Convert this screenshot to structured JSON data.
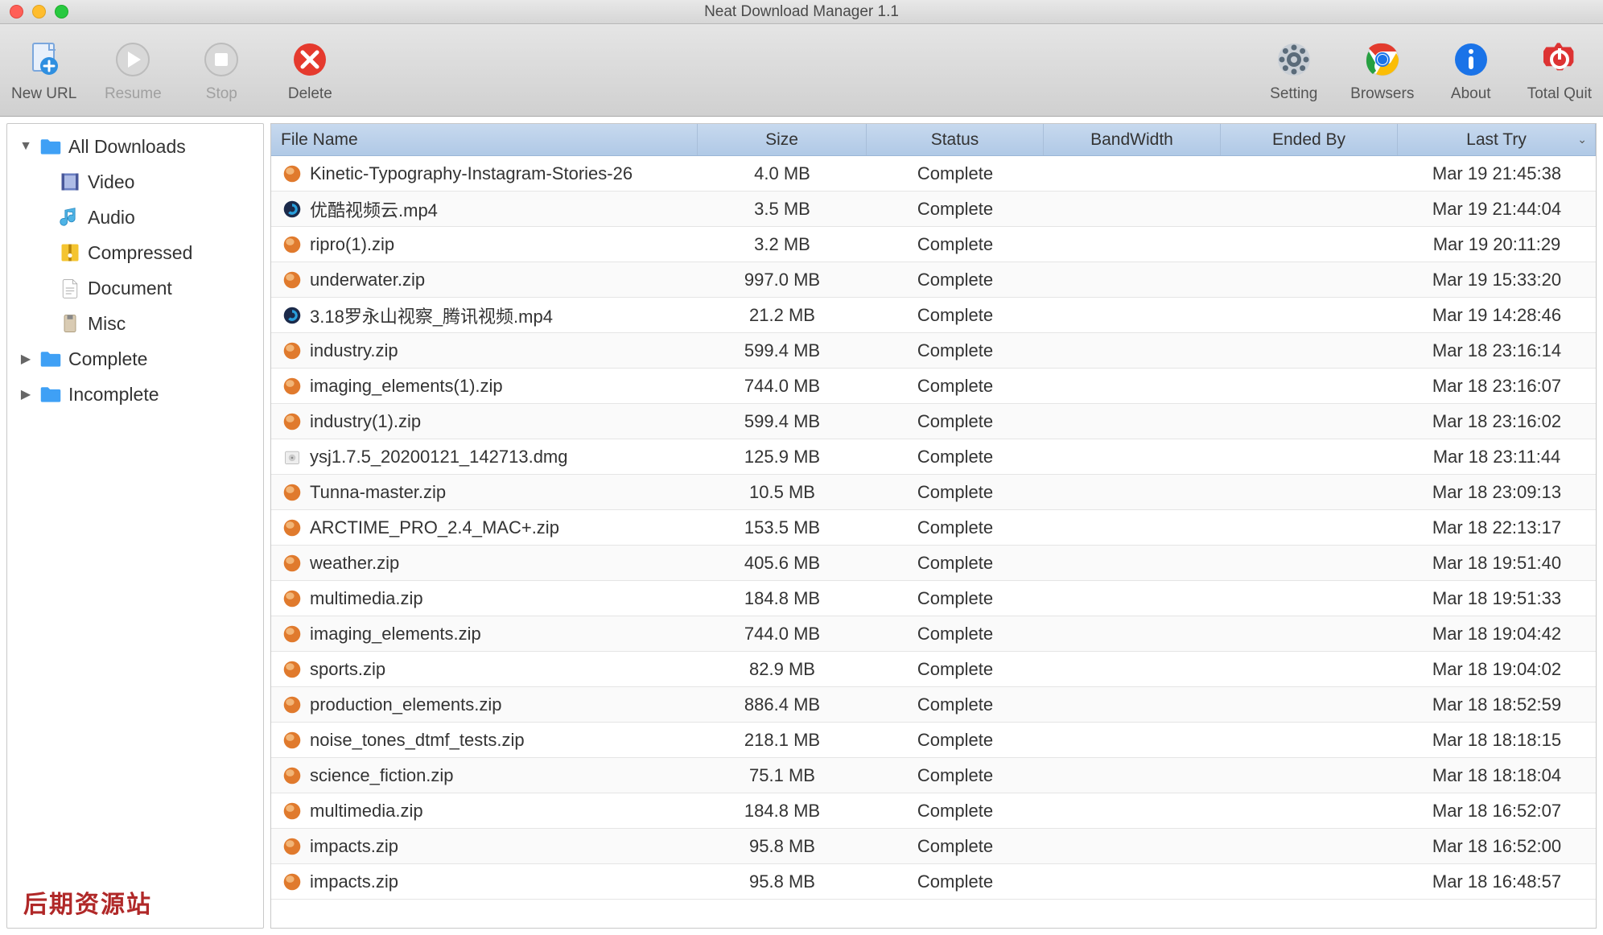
{
  "window": {
    "title": "Neat Download Manager 1.1"
  },
  "toolbar": {
    "left": [
      {
        "id": "new-url",
        "label": "New URL",
        "icon": "new-url-icon",
        "disabled": false
      },
      {
        "id": "resume",
        "label": "Resume",
        "icon": "play-icon",
        "disabled": true
      },
      {
        "id": "stop",
        "label": "Stop",
        "icon": "stop-icon",
        "disabled": true
      },
      {
        "id": "delete",
        "label": "Delete",
        "icon": "delete-icon",
        "disabled": false
      }
    ],
    "right": [
      {
        "id": "setting",
        "label": "Setting",
        "icon": "gear-icon"
      },
      {
        "id": "browsers",
        "label": "Browsers",
        "icon": "chrome-icon"
      },
      {
        "id": "about",
        "label": "About",
        "icon": "info-icon"
      },
      {
        "id": "total-quit",
        "label": "Total Quit",
        "icon": "power-icon"
      }
    ]
  },
  "sidebar": {
    "items": [
      {
        "label": "All Downloads",
        "icon": "folder-icon",
        "expanded": true,
        "depth": 0
      },
      {
        "label": "Video",
        "icon": "video-icon",
        "depth": 1
      },
      {
        "label": "Audio",
        "icon": "audio-icon",
        "depth": 1
      },
      {
        "label": "Compressed",
        "icon": "compressed-icon",
        "depth": 1
      },
      {
        "label": "Document",
        "icon": "document-icon",
        "depth": 1
      },
      {
        "label": "Misc",
        "icon": "misc-icon",
        "depth": 1
      },
      {
        "label": "Complete",
        "icon": "folder-icon",
        "expanded": false,
        "depth": 0
      },
      {
        "label": "Incomplete",
        "icon": "folder-icon",
        "expanded": false,
        "depth": 0
      }
    ],
    "watermark": "后期资源站"
  },
  "table": {
    "columns": [
      {
        "key": "fn",
        "label": "File Name",
        "align": "left"
      },
      {
        "key": "sz",
        "label": "Size",
        "align": "center"
      },
      {
        "key": "st",
        "label": "Status",
        "align": "center"
      },
      {
        "key": "bw",
        "label": "BandWidth",
        "align": "center"
      },
      {
        "key": "eb",
        "label": "Ended By",
        "align": "center"
      },
      {
        "key": "lt",
        "label": "Last Try",
        "align": "center",
        "sort": true
      }
    ],
    "rows": [
      {
        "icon": "orb",
        "fn": "Kinetic-Typography-Instagram-Stories-26",
        "sz": "4.0 MB",
        "st": "Complete",
        "bw": "",
        "eb": "",
        "lt": "Mar 19  21:45:38"
      },
      {
        "icon": "qt",
        "fn": "优酷视频云.mp4",
        "sz": "3.5 MB",
        "st": "Complete",
        "bw": "",
        "eb": "",
        "lt": "Mar 19  21:44:04"
      },
      {
        "icon": "orb",
        "fn": "ripro(1).zip",
        "sz": "3.2 MB",
        "st": "Complete",
        "bw": "",
        "eb": "",
        "lt": "Mar 19  20:11:29"
      },
      {
        "icon": "orb",
        "fn": "underwater.zip",
        "sz": "997.0 MB",
        "st": "Complete",
        "bw": "",
        "eb": "",
        "lt": "Mar 19  15:33:20"
      },
      {
        "icon": "qt",
        "fn": "3.18罗永山视察_腾讯视频.mp4",
        "sz": "21.2 MB",
        "st": "Complete",
        "bw": "",
        "eb": "",
        "lt": "Mar 19  14:28:46"
      },
      {
        "icon": "orb",
        "fn": "industry.zip",
        "sz": "599.4 MB",
        "st": "Complete",
        "bw": "",
        "eb": "",
        "lt": "Mar 18  23:16:14"
      },
      {
        "icon": "orb",
        "fn": "imaging_elements(1).zip",
        "sz": "744.0 MB",
        "st": "Complete",
        "bw": "",
        "eb": "",
        "lt": "Mar 18  23:16:07"
      },
      {
        "icon": "orb",
        "fn": "industry(1).zip",
        "sz": "599.4 MB",
        "st": "Complete",
        "bw": "",
        "eb": "",
        "lt": "Mar 18  23:16:02"
      },
      {
        "icon": "dmg",
        "fn": "ysj1.7.5_20200121_142713.dmg",
        "sz": "125.9 MB",
        "st": "Complete",
        "bw": "",
        "eb": "",
        "lt": "Mar 18  23:11:44"
      },
      {
        "icon": "orb",
        "fn": "Tunna-master.zip",
        "sz": "10.5 MB",
        "st": "Complete",
        "bw": "",
        "eb": "",
        "lt": "Mar 18  23:09:13"
      },
      {
        "icon": "orb",
        "fn": "ARCTIME_PRO_2.4_MAC+.zip",
        "sz": "153.5 MB",
        "st": "Complete",
        "bw": "",
        "eb": "",
        "lt": "Mar 18  22:13:17"
      },
      {
        "icon": "orb",
        "fn": "weather.zip",
        "sz": "405.6 MB",
        "st": "Complete",
        "bw": "",
        "eb": "",
        "lt": "Mar 18  19:51:40"
      },
      {
        "icon": "orb",
        "fn": "multimedia.zip",
        "sz": "184.8 MB",
        "st": "Complete",
        "bw": "",
        "eb": "",
        "lt": "Mar 18  19:51:33"
      },
      {
        "icon": "orb",
        "fn": "imaging_elements.zip",
        "sz": "744.0 MB",
        "st": "Complete",
        "bw": "",
        "eb": "",
        "lt": "Mar 18  19:04:42"
      },
      {
        "icon": "orb",
        "fn": "sports.zip",
        "sz": "82.9 MB",
        "st": "Complete",
        "bw": "",
        "eb": "",
        "lt": "Mar 18  19:04:02"
      },
      {
        "icon": "orb",
        "fn": "production_elements.zip",
        "sz": "886.4 MB",
        "st": "Complete",
        "bw": "",
        "eb": "",
        "lt": "Mar 18  18:52:59"
      },
      {
        "icon": "orb",
        "fn": "noise_tones_dtmf_tests.zip",
        "sz": "218.1 MB",
        "st": "Complete",
        "bw": "",
        "eb": "",
        "lt": "Mar 18  18:18:15"
      },
      {
        "icon": "orb",
        "fn": "science_fiction.zip",
        "sz": "75.1 MB",
        "st": "Complete",
        "bw": "",
        "eb": "",
        "lt": "Mar 18  18:18:04"
      },
      {
        "icon": "orb",
        "fn": "multimedia.zip",
        "sz": "184.8 MB",
        "st": "Complete",
        "bw": "",
        "eb": "",
        "lt": "Mar 18  16:52:07"
      },
      {
        "icon": "orb",
        "fn": "impacts.zip",
        "sz": "95.8 MB",
        "st": "Complete",
        "bw": "",
        "eb": "",
        "lt": "Mar 18  16:52:00"
      },
      {
        "icon": "orb",
        "fn": "impacts.zip",
        "sz": "95.8 MB",
        "st": "Complete",
        "bw": "",
        "eb": "",
        "lt": "Mar 18  16:48:57"
      }
    ]
  }
}
